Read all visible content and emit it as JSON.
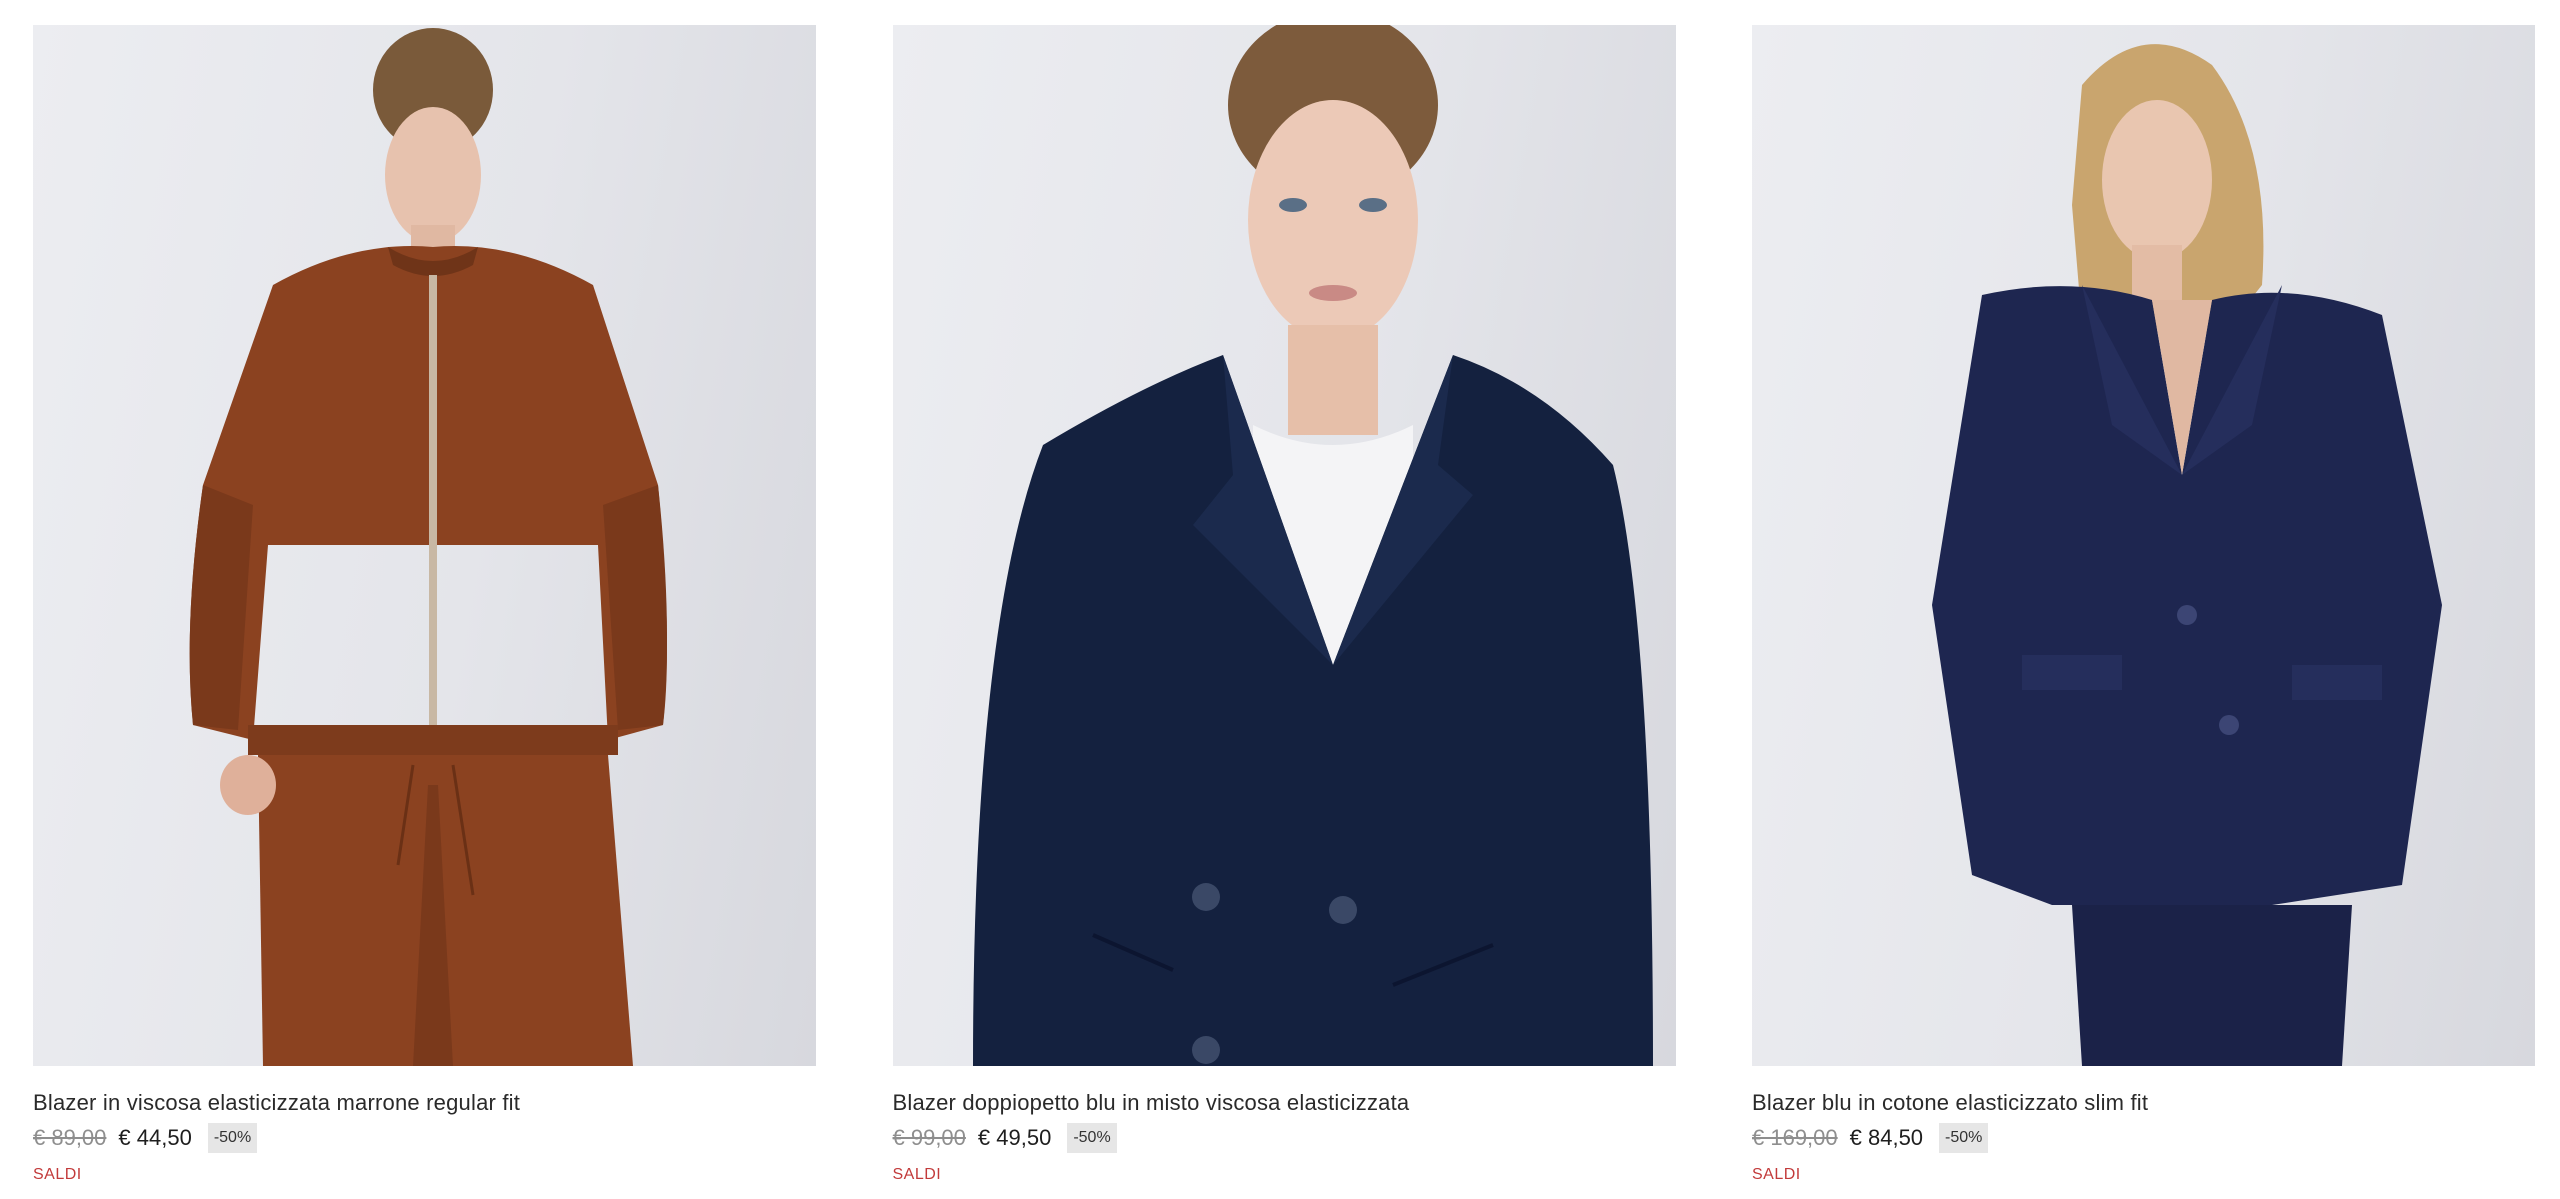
{
  "products": [
    {
      "title": "Blazer in viscosa elasticizzata marrone regular fit",
      "old_price": "€ 89,00",
      "new_price": "€ 44,50",
      "discount": "-50%",
      "tag": "SALDI"
    },
    {
      "title": "Blazer doppiopetto blu in misto viscosa elasticizzata",
      "old_price": "€ 99,00",
      "new_price": "€ 49,50",
      "discount": "-50%",
      "tag": "SALDI"
    },
    {
      "title": "Blazer blu in cotone elasticizzato slim fit",
      "old_price": "€ 169,00",
      "new_price": "€ 84,50",
      "discount": "-50%",
      "tag": "SALDI"
    }
  ],
  "colors": {
    "sale_red": "#c23a3a",
    "badge_bg": "#e6e6e6",
    "old_price_grey": "#8e8e8e",
    "photo_bg": "#e4e5ea"
  }
}
